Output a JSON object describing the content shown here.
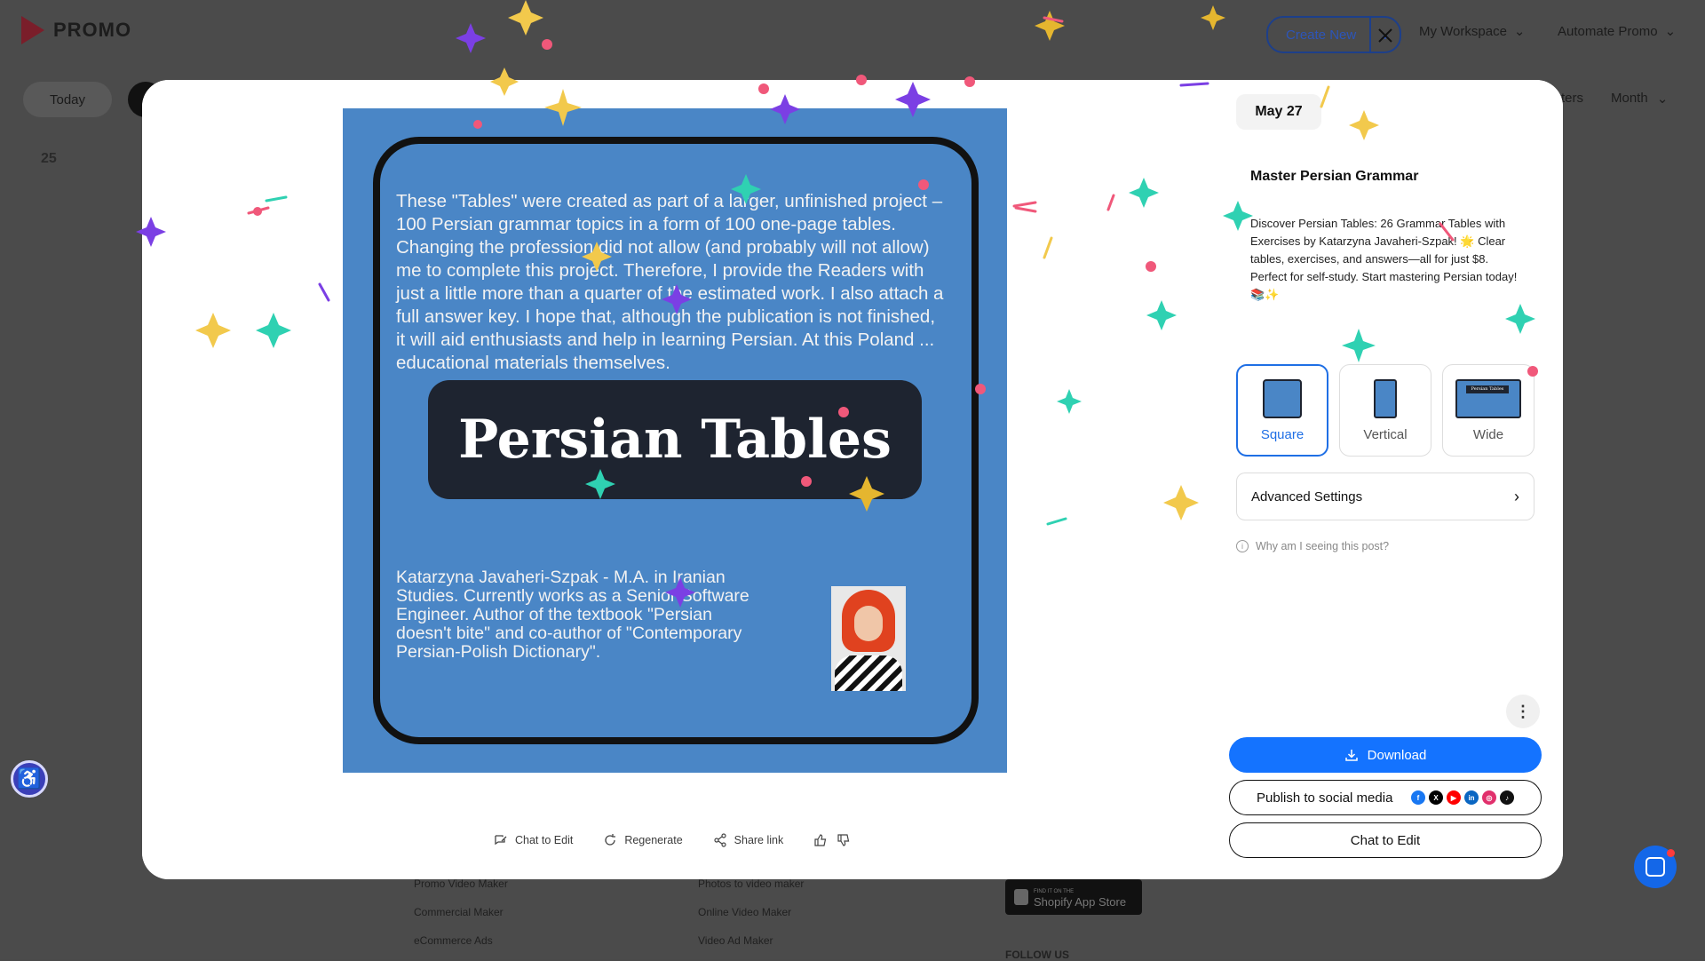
{
  "app": {
    "logo_text": "PROMO",
    "create_new": "Create New",
    "my_workspace": "My Workspace",
    "automate": "Automate Promo",
    "today": "Today",
    "filters_partial": "ters",
    "month": "Month",
    "day_number": "25"
  },
  "footer": {
    "col1": [
      "Promo Video Maker",
      "Commercial Maker",
      "eCommerce Ads"
    ],
    "col2": [
      "Photos to video maker",
      "Online Video Maker",
      "Video Ad Maker"
    ],
    "store_badge": "Shopify App Store",
    "store_badge_small": "FIND IT ON THE",
    "follow": "FOLLOW US"
  },
  "preview": {
    "body_text": "These \"Tables\" were created as part of a larger, unfinished project – 100 Persian grammar topics in a form of 100 one-page tables. Changing the profession did not allow (and probably will not allow) me to complete this project. Therefore, I provide the Readers with just a little more than a quarter of the estimated work. I also attach a full answer key. I hope that, although the publication is not finished, it will aid enthusiasts and help in learning Persian. At this Poland ... educational materials themselves.",
    "title": "Persian Tables",
    "author": "Katarzyna Javaheri-Szpak - M.A. in Iranian Studies. Currently works as a Senior Software Engineer. Author of the textbook \"Persian doesn't bite\" and co-author of \"Contemporary Persian-Polish Dictionary\"."
  },
  "actions": {
    "chat_to_edit": "Chat to Edit",
    "regenerate": "Regenerate",
    "share_link": "Share link"
  },
  "panel": {
    "date": "May 27",
    "post_title": "Master Persian Grammar",
    "post_desc": "Discover Persian Tables: 26 Grammar Tables with Exercises by Katarzyna Javaheri-Szpak! 🌟 Clear tables, exercises, and answers—all for just $8. Perfect for self-study. Start mastering Persian today! 📚✨",
    "formats": [
      {
        "label": "Square",
        "selected": true
      },
      {
        "label": "Vertical",
        "selected": false
      },
      {
        "label": "Wide",
        "selected": false
      }
    ],
    "wide_thumb_text": "Persian Tables",
    "advanced_settings": "Advanced Settings",
    "why_seeing": "Why am I seeing this post?",
    "download": "Download",
    "publish": "Publish to social media",
    "chat_to_edit": "Chat to Edit"
  },
  "colors": {
    "primary": "#1473ff",
    "preview_bg": "#4a86c6",
    "dark_title": "#1e2430"
  }
}
